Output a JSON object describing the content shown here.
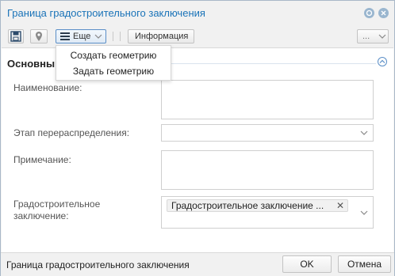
{
  "window": {
    "title": "Граница градостроительного заключения"
  },
  "toolbar": {
    "more_label": "Еще",
    "info_label": "Информация",
    "overflow_label": "..."
  },
  "menu": {
    "items": [
      {
        "label": "Создать геометрию"
      },
      {
        "label": "Задать геометрию"
      }
    ]
  },
  "section": {
    "title": "Основны"
  },
  "fields": {
    "name": {
      "label": "Наименование:",
      "value": ""
    },
    "stage": {
      "label": "Этап перераспределения:",
      "value": ""
    },
    "note": {
      "label": "Примечание:",
      "value": ""
    },
    "conclusion": {
      "label_line1": "Градостроительное",
      "label_line2": "заключение:",
      "tag": "Градостроительное заключение ..."
    }
  },
  "footer": {
    "status": "Граница градостроительного заключения",
    "ok_label": "OK",
    "cancel_label": "Отмена"
  },
  "colors": {
    "accent": "#1a73b8",
    "border": "#a9b8c8"
  }
}
